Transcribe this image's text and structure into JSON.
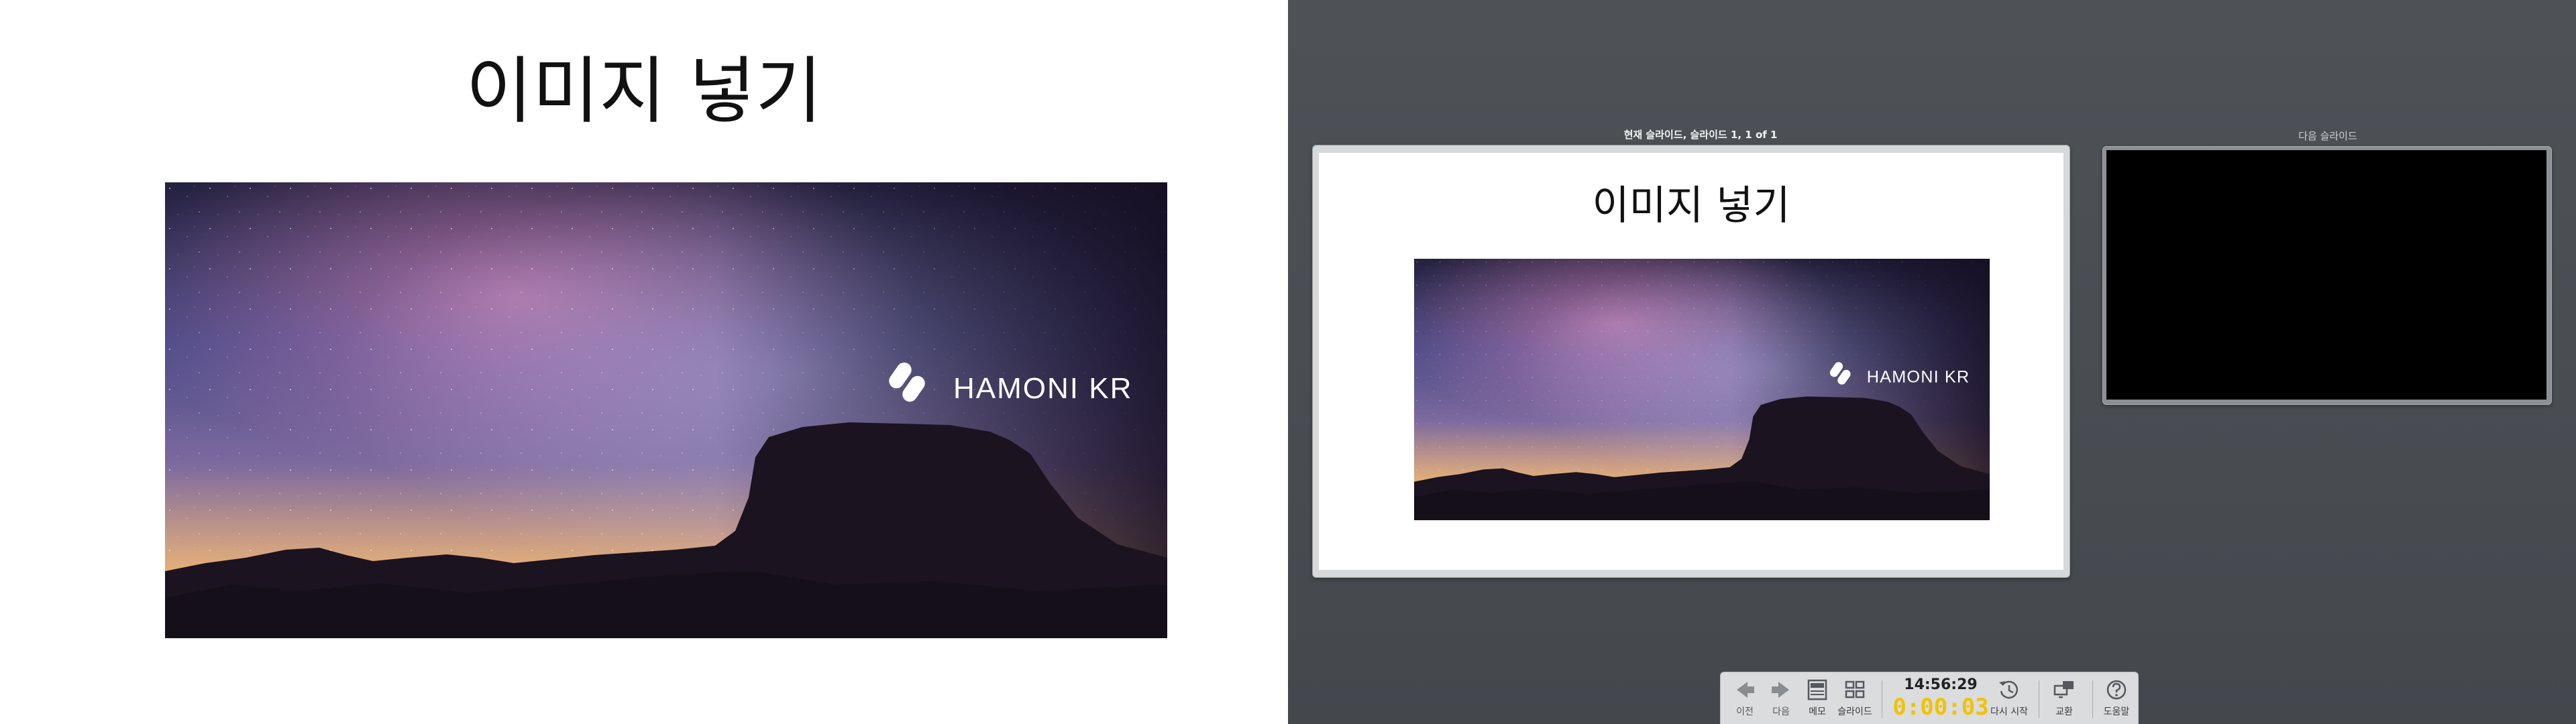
{
  "slide": {
    "title": "이미지 넣기",
    "image_logo_text": "HAMONI KR",
    "image_icon": "hamoni-logo-icon"
  },
  "presenter": {
    "current_label": "현재 슬라이드, 슬라이드 1, 1 of 1",
    "next_label": "다음 슬라이드"
  },
  "toolbar": {
    "prev_label": "이전",
    "next_label": "다음",
    "notes_label": "메모",
    "slides_label": "슬라이드",
    "clock": "14:56:29",
    "elapsed": "0:00:03",
    "restart_label": "다시 시작",
    "exchange_label": "교환",
    "help_label": "도움말",
    "icons": [
      "arrow-left-icon",
      "arrow-right-icon",
      "notes-icon",
      "slides-grid-icon",
      "restart-clock-icon",
      "exchange-screens-icon",
      "help-icon"
    ]
  },
  "colors": {
    "presenter_bg": "#4e5257",
    "timer": "#f2c200",
    "toolbar_bg": "#dadcde",
    "next_slide_bg": "#000000"
  }
}
